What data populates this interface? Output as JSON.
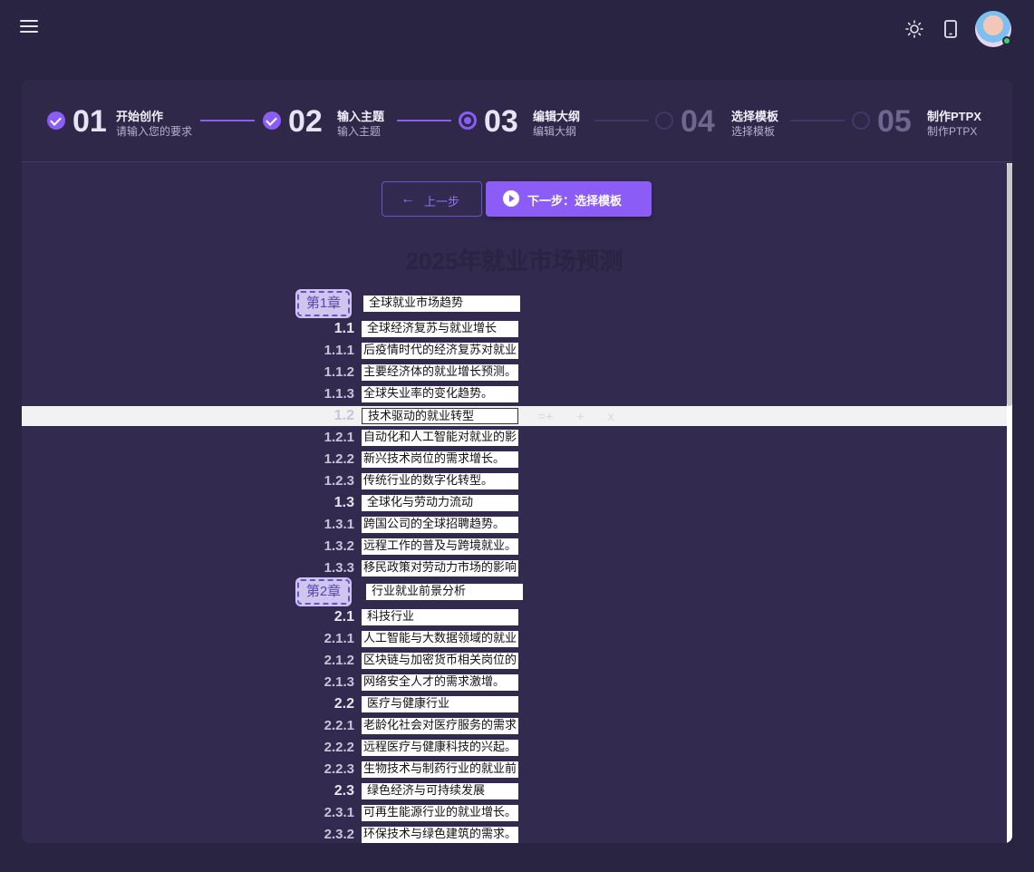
{
  "header": {
    "menu_icon": "hamburger-menu-icon",
    "theme_icon": "sun-icon",
    "device_icon": "phone-icon",
    "avatar_status_color": "#3bd16f"
  },
  "colors": {
    "accent": "#8b5cf6",
    "background": "#2a2443",
    "card": "#332b4f"
  },
  "steps": [
    {
      "num": "01",
      "title": "开始创作",
      "sub": "请输入您的要求",
      "state": "done"
    },
    {
      "num": "02",
      "title": "输入主题",
      "sub": "输入主题",
      "state": "done"
    },
    {
      "num": "03",
      "title": "编辑大纲",
      "sub": "编辑大纲",
      "state": "active"
    },
    {
      "num": "04",
      "title": "选择模板",
      "sub": "选择模板",
      "state": "todo"
    },
    {
      "num": "05",
      "title": "制作PTPX",
      "sub": "制作PTPX",
      "state": "todo"
    }
  ],
  "actions": {
    "prev_label": "上一步",
    "next_label": "下一步：选择模板"
  },
  "outline": {
    "title": "2025年就业市场预测",
    "row_tools": [
      "=+",
      "+",
      "x"
    ],
    "rows": [
      {
        "num": "第1章",
        "text": "全球就业市场趋势",
        "level": "chapter"
      },
      {
        "num": "1.1",
        "text": "全球经济复苏与就业增长",
        "level": "section"
      },
      {
        "num": "1.1.1",
        "text": "后疫情时代的经济复苏对就业",
        "level": "item"
      },
      {
        "num": "1.1.2",
        "text": "主要经济体的就业增长预测。",
        "level": "item"
      },
      {
        "num": "1.1.3",
        "text": "全球失业率的变化趋势。",
        "level": "item"
      },
      {
        "num": "1.2",
        "text": "技术驱动的就业转型",
        "level": "section",
        "highlight": true
      },
      {
        "num": "1.2.1",
        "text": "自动化和人工智能对就业的影",
        "level": "item"
      },
      {
        "num": "1.2.2",
        "text": "新兴技术岗位的需求增长。",
        "level": "item"
      },
      {
        "num": "1.2.3",
        "text": "传统行业的数字化转型。",
        "level": "item"
      },
      {
        "num": "1.3",
        "text": "全球化与劳动力流动",
        "level": "section"
      },
      {
        "num": "1.3.1",
        "text": "跨国公司的全球招聘趋势。",
        "level": "item"
      },
      {
        "num": "1.3.2",
        "text": "远程工作的普及与跨境就业。",
        "level": "item"
      },
      {
        "num": "1.3.3",
        "text": "移民政策对劳动力市场的影响",
        "level": "item"
      },
      {
        "num": "第2章",
        "text": "行业就业前景分析",
        "level": "chapter"
      },
      {
        "num": "2.1",
        "text": "科技行业",
        "level": "section"
      },
      {
        "num": "2.1.1",
        "text": "人工智能与大数据领域的就业",
        "level": "item"
      },
      {
        "num": "2.1.2",
        "text": "区块链与加密货币相关岗位的",
        "level": "item"
      },
      {
        "num": "2.1.3",
        "text": "网络安全人才的需求激增。",
        "level": "item"
      },
      {
        "num": "2.2",
        "text": "医疗与健康行业",
        "level": "section"
      },
      {
        "num": "2.2.1",
        "text": "老龄化社会对医疗服务的需求",
        "level": "item"
      },
      {
        "num": "2.2.2",
        "text": "远程医疗与健康科技的兴起。",
        "level": "item"
      },
      {
        "num": "2.2.3",
        "text": "生物技术与制药行业的就业前",
        "level": "item"
      },
      {
        "num": "2.3",
        "text": "绿色经济与可持续发展",
        "level": "section"
      },
      {
        "num": "2.3.1",
        "text": "可再生能源行业的就业增长。",
        "level": "item"
      },
      {
        "num": "2.3.2",
        "text": "环保技术与绿色建筑的需求。",
        "level": "item"
      }
    ]
  }
}
